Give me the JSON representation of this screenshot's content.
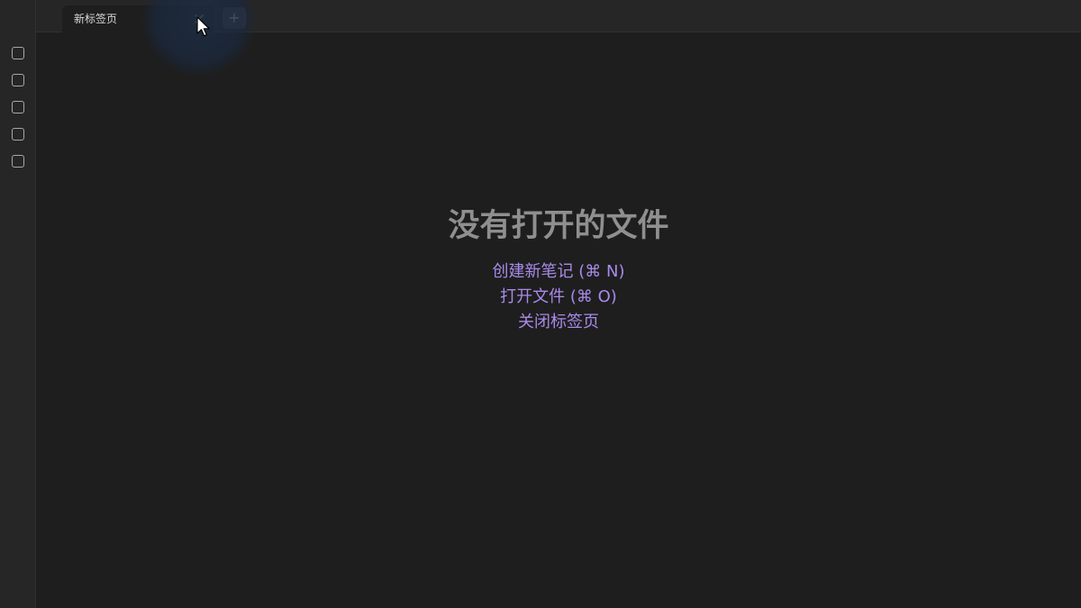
{
  "tab_header": {
    "tabs": [
      {
        "title": "新标签页",
        "close_icon": "close-icon"
      }
    ],
    "new_tab_icon": "plus-icon",
    "new_tab_glyph": "+"
  },
  "ribbon": {
    "buttons": [
      {
        "icon": "ribbon-square-icon-1"
      },
      {
        "icon": "ribbon-square-icon-2"
      },
      {
        "icon": "ribbon-square-icon-3"
      },
      {
        "icon": "ribbon-square-icon-4"
      },
      {
        "icon": "ribbon-square-icon-5"
      }
    ]
  },
  "empty_state": {
    "title": "没有打开的文件",
    "actions": [
      {
        "label": "创建新笔记 (⌘ N)"
      },
      {
        "label": "打开文件 (⌘ O)"
      },
      {
        "label": "关闭标签页"
      }
    ]
  },
  "colors": {
    "background": "#1e1e1e",
    "sidebar": "#262626",
    "accent": "#a98aea",
    "title_text": "#8f8f8f"
  }
}
